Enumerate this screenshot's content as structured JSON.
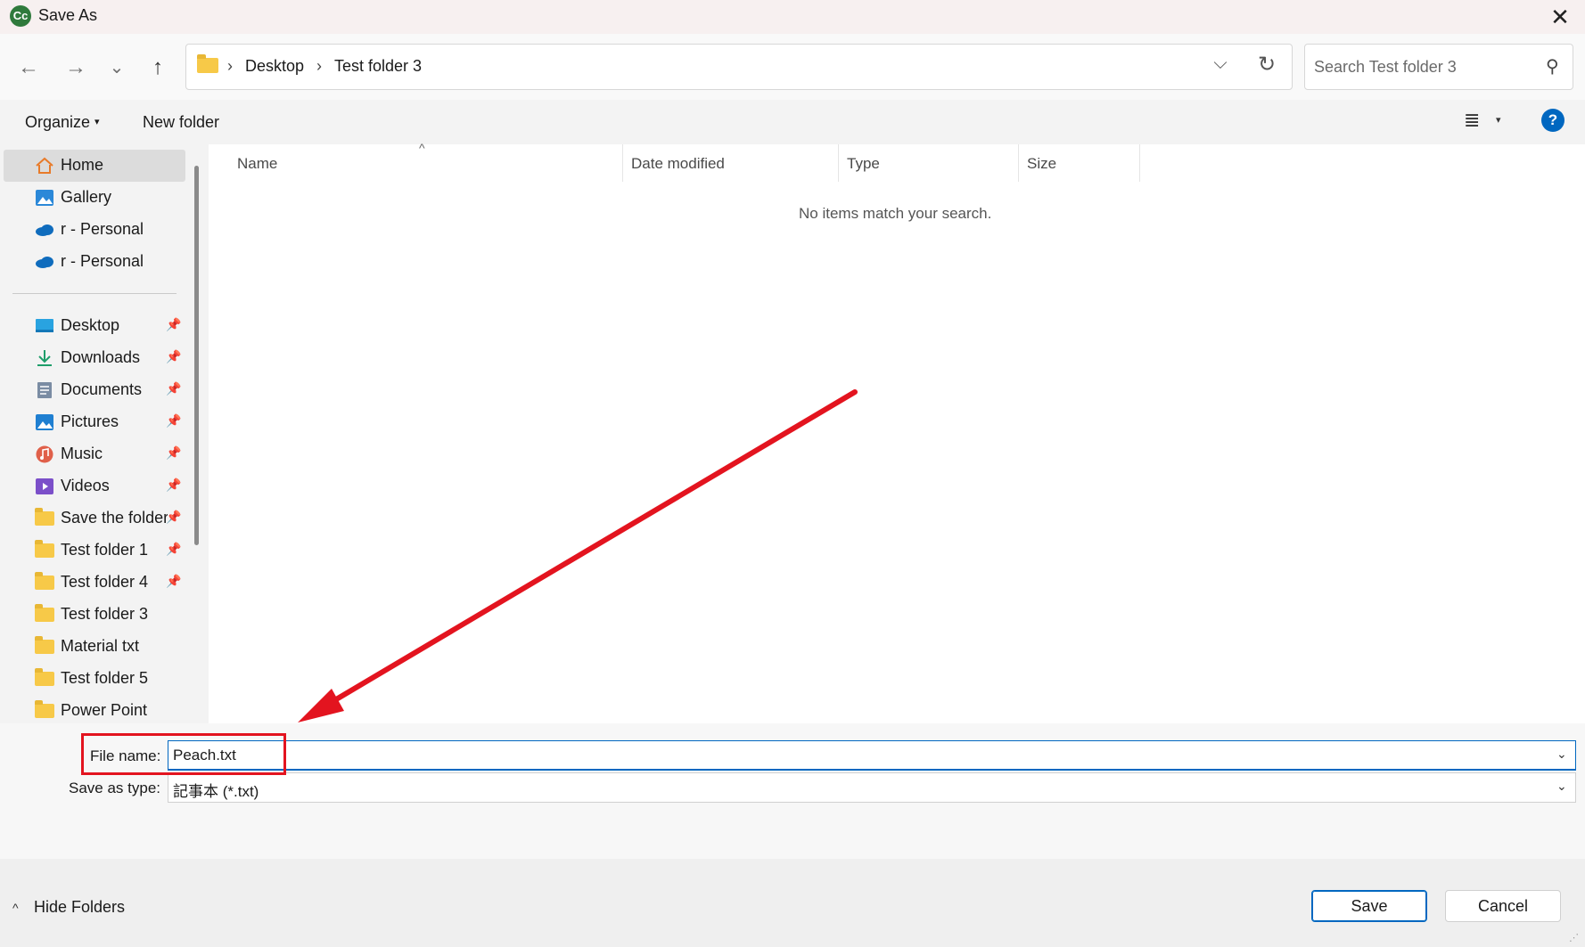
{
  "window": {
    "title": "Save As",
    "app_icon": "Cc",
    "close": "✕"
  },
  "nav": {
    "back_icon": "←",
    "forward_icon": "→",
    "recent_icon": "⌄",
    "up_icon": "↑",
    "breadcrumb": [
      "Desktop",
      "Test folder 3"
    ],
    "separator": "›",
    "dropdown_icon": "⌵",
    "refresh_icon": "↻",
    "search_placeholder": "Search Test folder 3",
    "search_icon": "⚲"
  },
  "toolbar": {
    "organize": "Organize",
    "organize_caret": "▾",
    "new_folder": "New folder",
    "view_icon": "≣",
    "view_caret": "▾",
    "help": "?"
  },
  "sidebar": {
    "quick": [
      {
        "label": "Home",
        "icon": "home-icon"
      },
      {
        "label": "Gallery",
        "icon": "gallery-icon"
      },
      {
        "label": "r - Personal",
        "icon": "onedrive-icon"
      },
      {
        "label": "r - Personal",
        "icon": "onedrive-icon"
      }
    ],
    "pinned": [
      {
        "label": "Desktop",
        "icon": "desktop-icon",
        "pinned": true
      },
      {
        "label": "Downloads",
        "icon": "downloads-icon",
        "pinned": true
      },
      {
        "label": "Documents",
        "icon": "documents-icon",
        "pinned": true
      },
      {
        "label": "Pictures",
        "icon": "pictures-icon",
        "pinned": true
      },
      {
        "label": "Music",
        "icon": "music-icon",
        "pinned": true
      },
      {
        "label": "Videos",
        "icon": "videos-icon",
        "pinned": true
      },
      {
        "label": "Save the folder",
        "icon": "folder-icon",
        "pinned": true
      },
      {
        "label": "Test folder 1",
        "icon": "folder-icon",
        "pinned": true
      },
      {
        "label": "Test folder 4",
        "icon": "folder-icon",
        "pinned": true
      },
      {
        "label": "Test folder 3",
        "icon": "folder-icon",
        "pinned": false
      },
      {
        "label": "Material txt",
        "icon": "folder-icon",
        "pinned": false
      },
      {
        "label": "Test folder 5",
        "icon": "folder-icon",
        "pinned": false
      },
      {
        "label": "Power Point",
        "icon": "folder-icon",
        "pinned": false
      }
    ],
    "pin_glyph": "📌"
  },
  "filelist": {
    "columns": [
      "Name",
      "Date modified",
      "Type",
      "Size"
    ],
    "sort_indicator": "^",
    "empty_message": "No items match your search."
  },
  "form": {
    "file_name_label": "File name:",
    "file_name_value": "Peach.txt",
    "save_type_label": "Save as type:",
    "save_type_value": "記事本 (*.txt)",
    "dropdown_icon": "⌄"
  },
  "footer": {
    "hide_folders": "Hide Folders",
    "hide_caret": "^",
    "save": "Save",
    "cancel": "Cancel"
  },
  "annotation_color": "#e3141f",
  "accent_color": "#0067c0"
}
